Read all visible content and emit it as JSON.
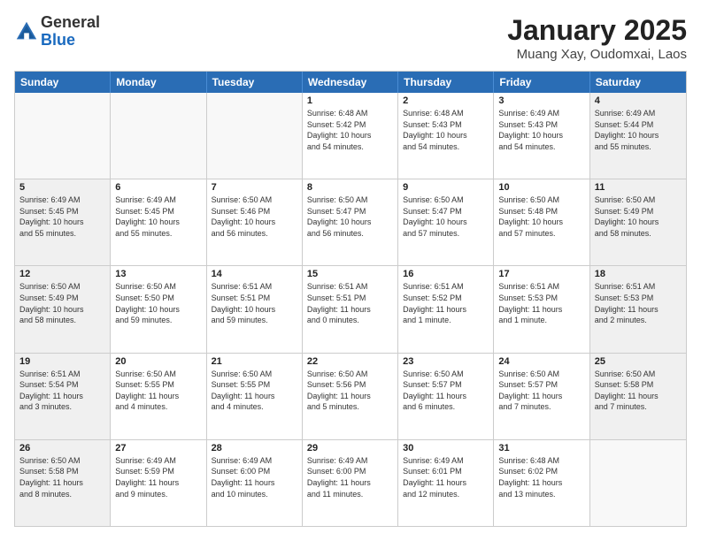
{
  "header": {
    "logo_line1": "General",
    "logo_line2": "Blue",
    "month_year": "January 2025",
    "location": "Muang Xay, Oudomxai, Laos"
  },
  "days_of_week": [
    "Sunday",
    "Monday",
    "Tuesday",
    "Wednesday",
    "Thursday",
    "Friday",
    "Saturday"
  ],
  "weeks": [
    [
      {
        "day": "",
        "info": ""
      },
      {
        "day": "",
        "info": ""
      },
      {
        "day": "",
        "info": ""
      },
      {
        "day": "1",
        "info": "Sunrise: 6:48 AM\nSunset: 5:42 PM\nDaylight: 10 hours\nand 54 minutes."
      },
      {
        "day": "2",
        "info": "Sunrise: 6:48 AM\nSunset: 5:43 PM\nDaylight: 10 hours\nand 54 minutes."
      },
      {
        "day": "3",
        "info": "Sunrise: 6:49 AM\nSunset: 5:43 PM\nDaylight: 10 hours\nand 54 minutes."
      },
      {
        "day": "4",
        "info": "Sunrise: 6:49 AM\nSunset: 5:44 PM\nDaylight: 10 hours\nand 55 minutes."
      }
    ],
    [
      {
        "day": "5",
        "info": "Sunrise: 6:49 AM\nSunset: 5:45 PM\nDaylight: 10 hours\nand 55 minutes."
      },
      {
        "day": "6",
        "info": "Sunrise: 6:49 AM\nSunset: 5:45 PM\nDaylight: 10 hours\nand 55 minutes."
      },
      {
        "day": "7",
        "info": "Sunrise: 6:50 AM\nSunset: 5:46 PM\nDaylight: 10 hours\nand 56 minutes."
      },
      {
        "day": "8",
        "info": "Sunrise: 6:50 AM\nSunset: 5:47 PM\nDaylight: 10 hours\nand 56 minutes."
      },
      {
        "day": "9",
        "info": "Sunrise: 6:50 AM\nSunset: 5:47 PM\nDaylight: 10 hours\nand 57 minutes."
      },
      {
        "day": "10",
        "info": "Sunrise: 6:50 AM\nSunset: 5:48 PM\nDaylight: 10 hours\nand 57 minutes."
      },
      {
        "day": "11",
        "info": "Sunrise: 6:50 AM\nSunset: 5:49 PM\nDaylight: 10 hours\nand 58 minutes."
      }
    ],
    [
      {
        "day": "12",
        "info": "Sunrise: 6:50 AM\nSunset: 5:49 PM\nDaylight: 10 hours\nand 58 minutes."
      },
      {
        "day": "13",
        "info": "Sunrise: 6:50 AM\nSunset: 5:50 PM\nDaylight: 10 hours\nand 59 minutes."
      },
      {
        "day": "14",
        "info": "Sunrise: 6:51 AM\nSunset: 5:51 PM\nDaylight: 10 hours\nand 59 minutes."
      },
      {
        "day": "15",
        "info": "Sunrise: 6:51 AM\nSunset: 5:51 PM\nDaylight: 11 hours\nand 0 minutes."
      },
      {
        "day": "16",
        "info": "Sunrise: 6:51 AM\nSunset: 5:52 PM\nDaylight: 11 hours\nand 1 minute."
      },
      {
        "day": "17",
        "info": "Sunrise: 6:51 AM\nSunset: 5:53 PM\nDaylight: 11 hours\nand 1 minute."
      },
      {
        "day": "18",
        "info": "Sunrise: 6:51 AM\nSunset: 5:53 PM\nDaylight: 11 hours\nand 2 minutes."
      }
    ],
    [
      {
        "day": "19",
        "info": "Sunrise: 6:51 AM\nSunset: 5:54 PM\nDaylight: 11 hours\nand 3 minutes."
      },
      {
        "day": "20",
        "info": "Sunrise: 6:50 AM\nSunset: 5:55 PM\nDaylight: 11 hours\nand 4 minutes."
      },
      {
        "day": "21",
        "info": "Sunrise: 6:50 AM\nSunset: 5:55 PM\nDaylight: 11 hours\nand 4 minutes."
      },
      {
        "day": "22",
        "info": "Sunrise: 6:50 AM\nSunset: 5:56 PM\nDaylight: 11 hours\nand 5 minutes."
      },
      {
        "day": "23",
        "info": "Sunrise: 6:50 AM\nSunset: 5:57 PM\nDaylight: 11 hours\nand 6 minutes."
      },
      {
        "day": "24",
        "info": "Sunrise: 6:50 AM\nSunset: 5:57 PM\nDaylight: 11 hours\nand 7 minutes."
      },
      {
        "day": "25",
        "info": "Sunrise: 6:50 AM\nSunset: 5:58 PM\nDaylight: 11 hours\nand 7 minutes."
      }
    ],
    [
      {
        "day": "26",
        "info": "Sunrise: 6:50 AM\nSunset: 5:58 PM\nDaylight: 11 hours\nand 8 minutes."
      },
      {
        "day": "27",
        "info": "Sunrise: 6:49 AM\nSunset: 5:59 PM\nDaylight: 11 hours\nand 9 minutes."
      },
      {
        "day": "28",
        "info": "Sunrise: 6:49 AM\nSunset: 6:00 PM\nDaylight: 11 hours\nand 10 minutes."
      },
      {
        "day": "29",
        "info": "Sunrise: 6:49 AM\nSunset: 6:00 PM\nDaylight: 11 hours\nand 11 minutes."
      },
      {
        "day": "30",
        "info": "Sunrise: 6:49 AM\nSunset: 6:01 PM\nDaylight: 11 hours\nand 12 minutes."
      },
      {
        "day": "31",
        "info": "Sunrise: 6:48 AM\nSunset: 6:02 PM\nDaylight: 11 hours\nand 13 minutes."
      },
      {
        "day": "",
        "info": ""
      }
    ]
  ]
}
